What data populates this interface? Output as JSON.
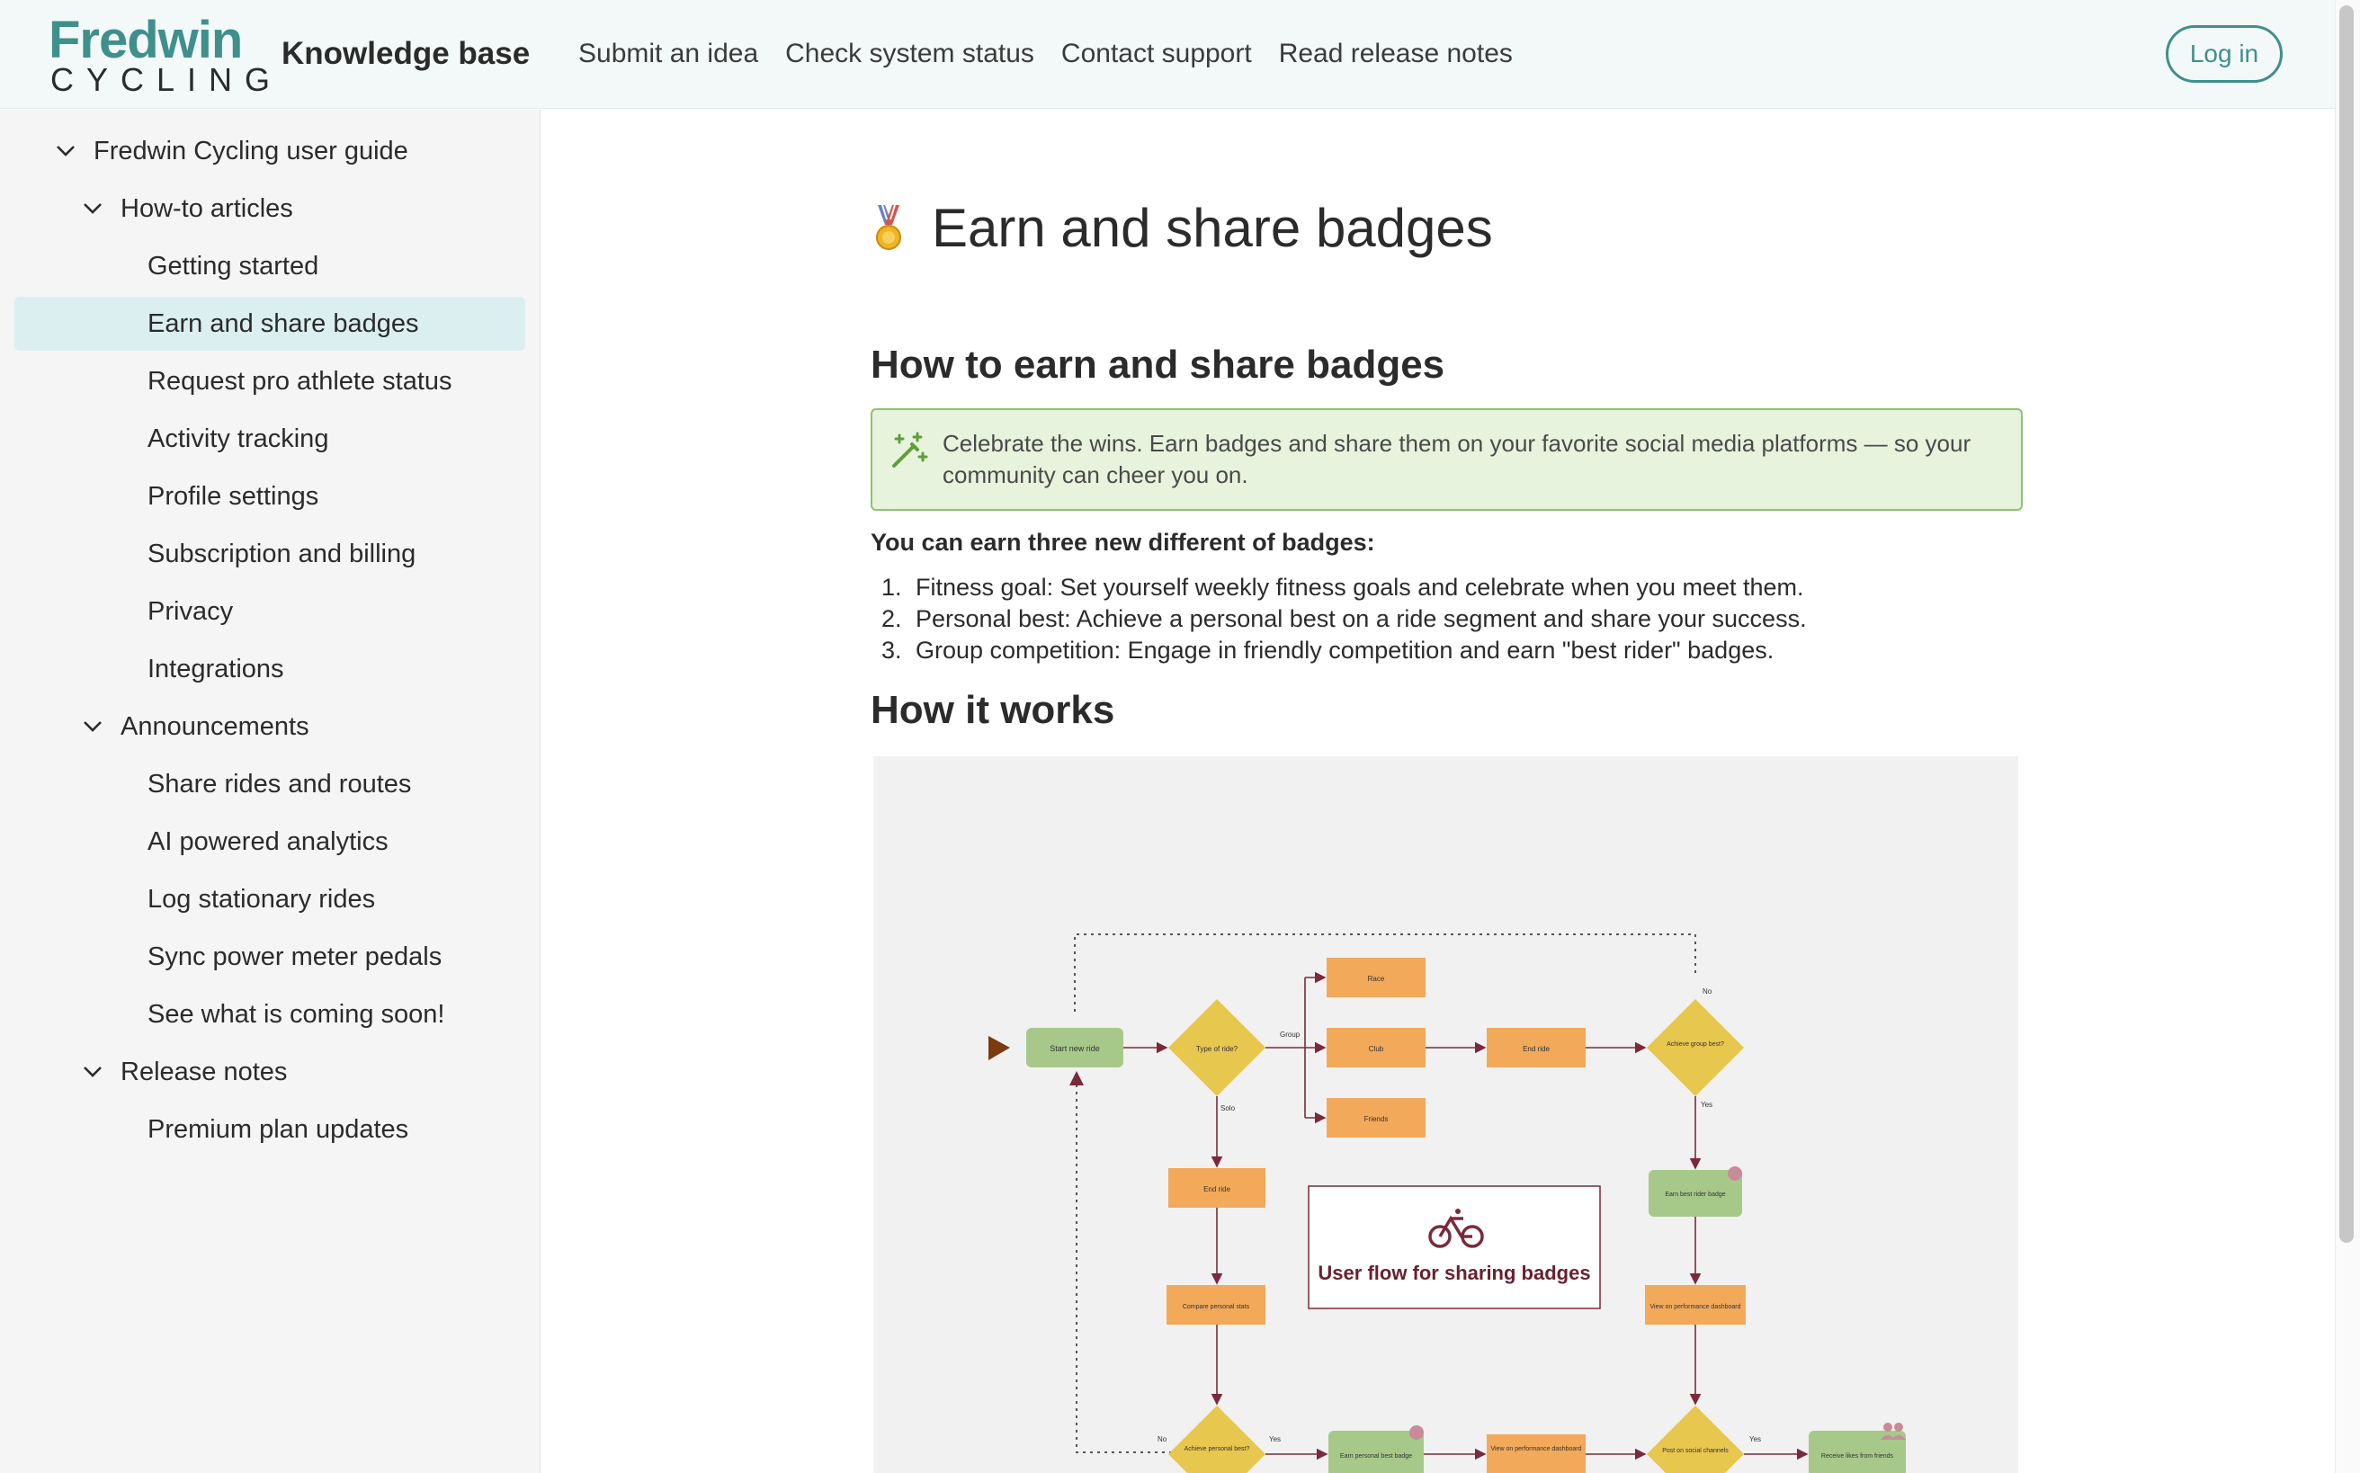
{
  "header": {
    "logo_top": "Fredwin",
    "logo_bottom": "CYCLING",
    "title": "Knowledge base",
    "nav": [
      "Submit an idea",
      "Check system status",
      "Contact support",
      "Read release notes"
    ],
    "login_label": "Log in",
    "accent_color": "#3f8f8c"
  },
  "sidebar": {
    "root": "Fredwin Cycling user guide",
    "sections": [
      {
        "label": "How-to articles",
        "items": [
          "Getting started",
          "Earn and share badges",
          "Request pro athlete status",
          "Activity tracking",
          "Profile settings",
          "Subscription and billing",
          "Privacy",
          "Integrations"
        ]
      },
      {
        "label": "Announcements",
        "items": [
          "Share rides and routes",
          "AI powered analytics",
          "Log stationary rides",
          "Sync power meter pedals",
          "See what is coming soon!"
        ]
      },
      {
        "label": "Release notes",
        "items": [
          "Premium plan updates"
        ]
      }
    ],
    "active_item": "Earn and share badges"
  },
  "article": {
    "title_icon": "medal-icon",
    "title": "Earn and share badges",
    "section1_heading": "How to earn and share badges",
    "callout_icon": "magic-wand-icon",
    "callout_text": "Celebrate the wins. Earn badges and share them on your favorite social media platforms — so your community can cheer you on.",
    "badges_intro": "You can earn three new different of badges:",
    "badges": [
      "Fitness goal: Set yourself weekly fitness goals and celebrate when you meet them.",
      "Personal best: Achieve a personal best on a ride segment and share your success.",
      "Group competition: Engage in friendly competition and earn \"best rider\" badges."
    ],
    "section2_heading": "How it works"
  },
  "diagram": {
    "title": "User flow for sharing badges",
    "icon": "bicycle-icon",
    "nodes": {
      "start": "Start new ride",
      "type_decision": "Type of ride?",
      "race": "Race",
      "club": "Club",
      "friends": "Friends",
      "end_ride_group": "End ride",
      "group_best": "Achieve group best?",
      "end_ride_solo": "End ride",
      "best_rider_badge": "Earn best rider badge",
      "compare": "Compare personal stats",
      "view_dash_group": "View on performance dashboard",
      "personal_best": "Achieve personal best?",
      "personal_badge": "Earn personal best  badge",
      "view_dash_solo": "View on performance dashboard",
      "post_social": "Post on social channels",
      "likes": "Receive likes from friends"
    },
    "labels": {
      "group": "Group",
      "solo": "Solo",
      "no_top": "No",
      "yes_right": "Yes",
      "no_left": "No",
      "yes_pb": "Yes",
      "yes_post": "Yes"
    }
  }
}
